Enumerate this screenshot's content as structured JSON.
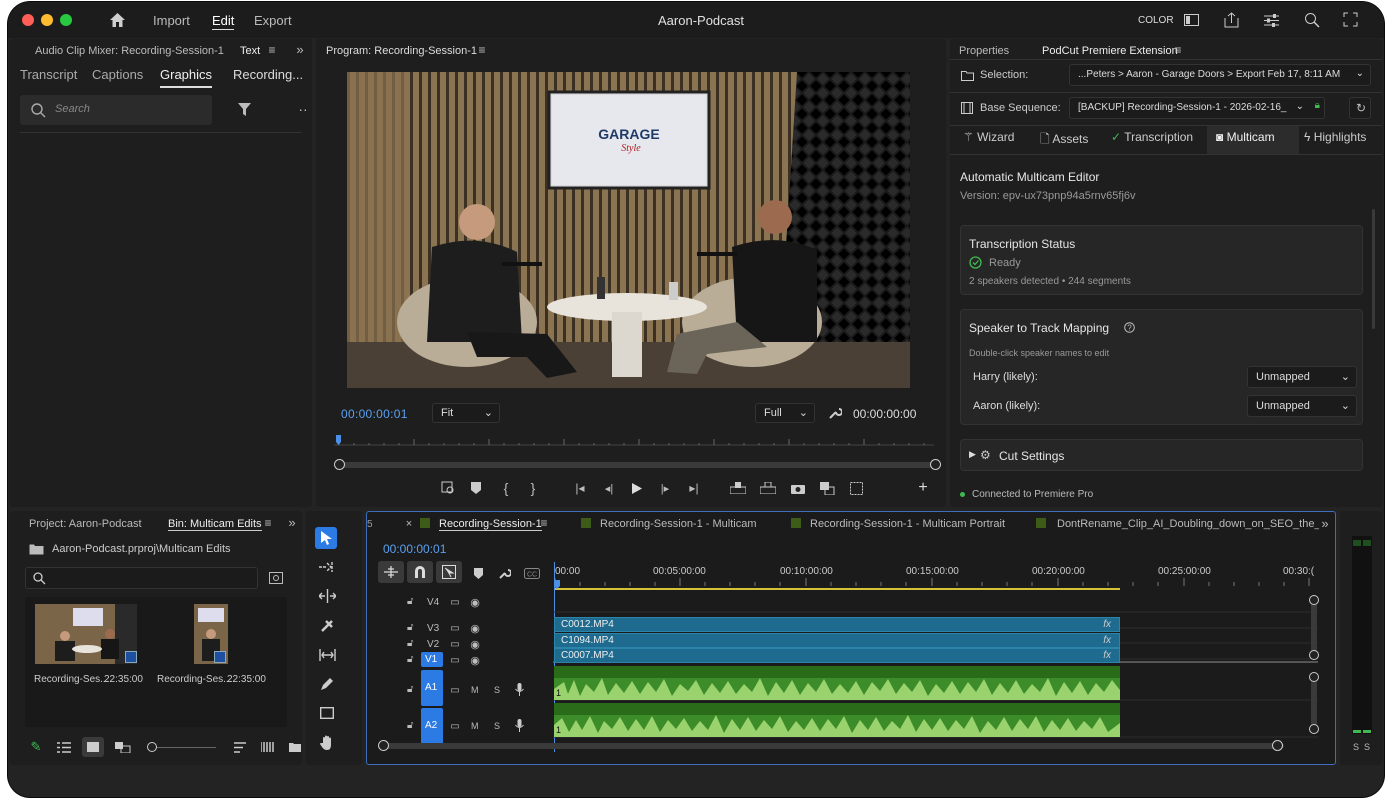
{
  "app": {
    "title": "Aaron-Podcast",
    "menu": [
      "Import",
      "Edit",
      "Export"
    ],
    "color_label": "COLOR"
  },
  "left_panel": {
    "title": "Audio Clip Mixer: Recording-Session-1",
    "text_tab": "Text",
    "tabs": [
      "Transcript",
      "Captions",
      "Graphics",
      "Recording..."
    ],
    "search_placeholder": "Search"
  },
  "program": {
    "title": "Program: Recording-Session-1",
    "timecode_left": "00:00:00:01",
    "fit": "Fit",
    "quality": "Full",
    "timecode_right": "00:00:00:00",
    "logo_line1": "GARAGE",
    "logo_line2": "Style"
  },
  "right_panel": {
    "tab_properties": "Properties",
    "tab_ext": "PodCut Premiere Extension",
    "selection_label": "Selection:",
    "selection_value": "...Peters > Aaron - Garage Doors > Export Feb 17, 8:11 AM",
    "base_label": "Base Sequence:",
    "base_value": "[BACKUP] Recording-Session-1 - 2026-02-16_",
    "tabs": [
      "Wizard",
      "Assets",
      "Transcription",
      "Multicam",
      "Highlights"
    ],
    "editor_title": "Automatic Multicam Editor",
    "version": "Version: epv-ux73pnp94a5rnv65fj6v",
    "status_title": "Transcription Status",
    "status_value": "Ready",
    "status_detail": "2 speakers detected • 244 segments",
    "mapping_title": "Speaker to Track Mapping",
    "mapping_hint": "Double-click speaker names to edit",
    "speakers": [
      {
        "name": "Harry (likely):",
        "value": "Unmapped"
      },
      {
        "name": "Aaron (likely):",
        "value": "Unmapped"
      }
    ],
    "cut_settings": "Cut Settings",
    "connected": "Connected to Premiere Pro"
  },
  "project": {
    "title": "Project: Aaron-Podcast",
    "bin_title": "Bin: Multicam Edits",
    "path": "Aaron-Podcast.prproj\\Multicam Edits",
    "items": [
      {
        "name": "Recording-Ses...",
        "duration": "22:35:00"
      },
      {
        "name": "Recording-Ses...",
        "duration": "22:35:00"
      }
    ]
  },
  "timeline": {
    "tabs": [
      "Recording-Session-1",
      "Recording-Session-1 - Multicam",
      "Recording-Session-1 - Multicam Portrait",
      "DontRename_Clip_AI_Doubling_down_on_SEO_the_ind..."
    ],
    "timecode": "00:00:00:01",
    "ruler": [
      "00:00",
      "00:05:00:00",
      "00:10:00:00",
      "00:15:00:00",
      "00:20:00:00",
      "00:25:00:00",
      "00:30:("
    ],
    "video_tracks": [
      "V4",
      "V3",
      "V2",
      "V1"
    ],
    "audio_tracks": [
      "A1",
      "A2"
    ],
    "clips": [
      "C0012.MP4",
      "C1094.MP4",
      "C0007.MP4"
    ],
    "fx": "fx",
    "m": "M",
    "s": "S",
    "clip_num": "1"
  },
  "meter": {
    "s1": "S",
    "s2": "S"
  }
}
